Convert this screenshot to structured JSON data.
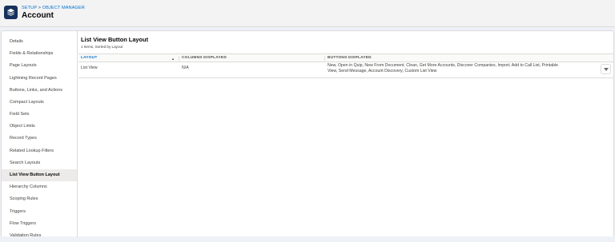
{
  "header": {
    "breadcrumb_setup": "SETUP",
    "breadcrumb_sep": " > ",
    "breadcrumb_object_manager": "OBJECT MANAGER",
    "title": "Account",
    "app_icon": "layers-icon"
  },
  "sidebar": {
    "items": [
      {
        "label": "Details"
      },
      {
        "label": "Fields & Relationships"
      },
      {
        "label": "Page Layouts"
      },
      {
        "label": "Lightning Record Pages"
      },
      {
        "label": "Buttons, Links, and Actions"
      },
      {
        "label": "Compact Layouts"
      },
      {
        "label": "Field Sets"
      },
      {
        "label": "Object Limits"
      },
      {
        "label": "Record Types"
      },
      {
        "label": "Related Lookup Filters"
      },
      {
        "label": "Search Layouts"
      },
      {
        "label": "List View Button Layout",
        "active": true
      },
      {
        "label": "Hierarchy Columns"
      },
      {
        "label": "Scoping Rules"
      },
      {
        "label": "Triggers"
      },
      {
        "label": "Flow Triggers"
      },
      {
        "label": "Validation Rules"
      }
    ]
  },
  "main": {
    "title": "List View Button Layout",
    "subtitle": "1 Items, Sorted by Layout",
    "columns": {
      "layout": "LAYOUT",
      "sort_indicator": "▲",
      "columns_displayed": "COLUMNS DISPLAYED",
      "buttons_displayed": "BUTTONS DISPLAYED"
    },
    "rows": [
      {
        "layout": "List View",
        "columns_displayed": "N/A",
        "buttons_line1": "New, Open in Quip, New From Document, Clean, Get More Accounts, Discover Companies, Import, Add to Call List, Printable",
        "buttons_line2": "View, Send Message, Account Discovery, Custom List View",
        "action_icon": "chevron-down-icon"
      }
    ]
  },
  "colors": {
    "brand": "#16325c",
    "link": "#0070d2",
    "active_item_bg": "#ecebea"
  }
}
